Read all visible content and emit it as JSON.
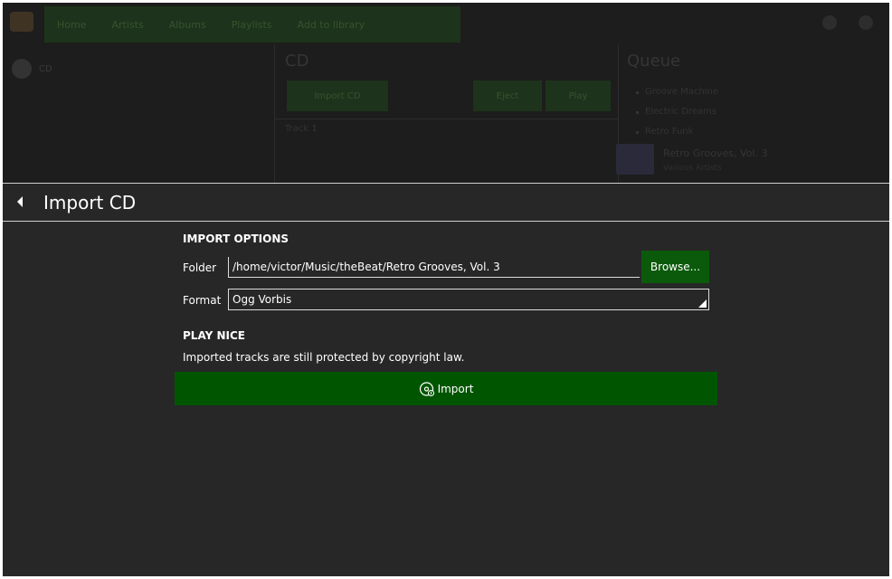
{
  "background": {
    "nav_items": [
      "Home",
      "Artists",
      "Albums",
      "Playlists",
      "Add to library"
    ],
    "sidebar_item_label": "CD",
    "main_title": "CD",
    "main_buttons": [
      "Import CD",
      "Eject",
      "Play"
    ],
    "main_subtext": "Track 1",
    "queue_title": "Queue",
    "queue_items": [
      "Groove Machine",
      "Electric Dreams",
      "Retro Funk"
    ],
    "now_playing_title": "Retro Grooves, Vol. 3",
    "now_playing_sub": "Various Artists"
  },
  "panel": {
    "title": "Import CD",
    "back_icon": "chevron-left-icon"
  },
  "import_options": {
    "heading": "IMPORT OPTIONS",
    "folder_label": "Folder",
    "folder_value": "/home/victor/Music/theBeat/Retro Grooves, Vol. 3",
    "browse_label": "Browse...",
    "format_label": "Format",
    "format_value": "Ogg Vorbis"
  },
  "play_nice": {
    "heading": "PLAY NICE",
    "text": "Imported tracks are still protected by copyright law."
  },
  "import_button": {
    "label": "Import",
    "icon": "disc-icon"
  },
  "colors": {
    "panel_bg": "#272727",
    "accent_green": "#005500",
    "browse_green": "#0b5a0b",
    "text": "#ffffff"
  }
}
